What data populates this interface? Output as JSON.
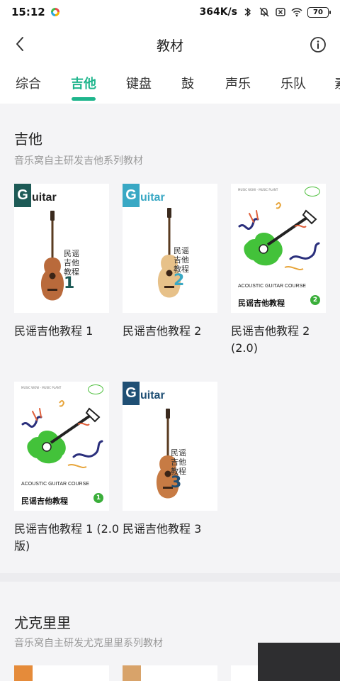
{
  "status": {
    "time": "15:12",
    "speed": "364K/s",
    "battery": "70"
  },
  "header": {
    "title": "教材",
    "back_icon": "back-arrow-icon",
    "info_icon": "info-icon"
  },
  "tabs": [
    {
      "label": "综合"
    },
    {
      "label": "吉他"
    },
    {
      "label": "键盘"
    },
    {
      "label": "鼓"
    },
    {
      "label": "声乐"
    },
    {
      "label": "乐队"
    },
    {
      "label": "素"
    }
  ],
  "active_tab": "吉他",
  "accent_color": "#1eb58c",
  "sections": [
    {
      "title": "吉他",
      "subtitle": "音乐窝自主研发吉他系列教材",
      "books": [
        {
          "title": "民谣吉他教程 1",
          "cover": {
            "logo_letter": "G",
            "logo_rest": "uitar",
            "cn": "民谣吉他教程",
            "number": "1",
            "color": "#1d5a56"
          }
        },
        {
          "title": "民谣吉他教程 2",
          "cover": {
            "logo_letter": "G",
            "logo_rest": "uitar",
            "cn": "民谣吉他教程",
            "number": "2",
            "color": "#39a8c4"
          }
        },
        {
          "title": "民谣吉他教程 2 (2.0)",
          "cover": {
            "brand": "MUSIC WOW - MUSIC PLANT",
            "course": "ACOUSTIC GUITAR COURSE",
            "cn": "民谣吉他教程",
            "number": "2"
          }
        },
        {
          "title": "民谣吉他教程 1 (2.0版)",
          "cover": {
            "brand": "MUSIC WOW - MUSIC PLANT",
            "course": "ACOUSTIC GUITAR COURSE",
            "cn": "民谣吉他教程",
            "number": "1"
          }
        },
        {
          "title": "民谣吉他教程 3",
          "cover": {
            "logo_letter": "G",
            "logo_rest": "uitar",
            "cn": "民谣吉他教程",
            "number": "3",
            "color": "#1f4f74"
          }
        }
      ]
    },
    {
      "title": "尤克里里",
      "subtitle": "音乐窝自主研发尤克里里系列教材"
    }
  ]
}
